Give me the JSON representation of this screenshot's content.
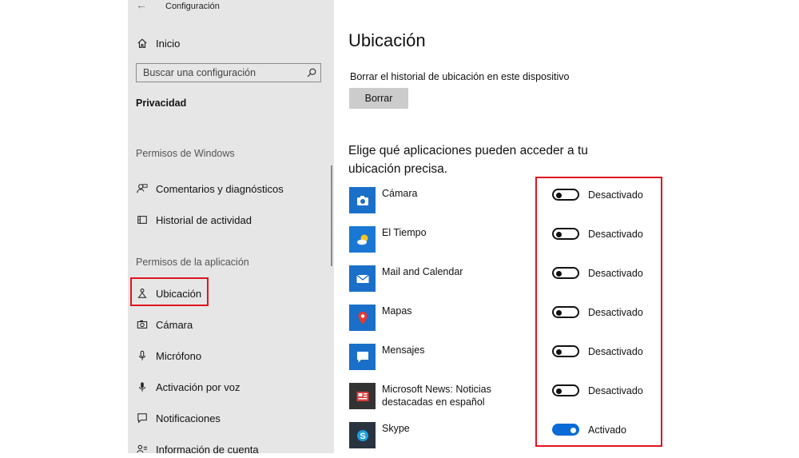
{
  "window": {
    "title": "Configuración"
  },
  "sidebar": {
    "home_label": "Inicio",
    "search_placeholder": "Buscar una configuración",
    "category": "Privacidad",
    "sections": [
      {
        "label": "Permisos de Windows"
      },
      {
        "label": "Permisos de la aplicación"
      }
    ],
    "items": [
      {
        "label": "Comentarios y diagnósticos",
        "icon": "feedback-icon"
      },
      {
        "label": "Historial de actividad",
        "icon": "activity-history-icon"
      },
      {
        "label": "Ubicación",
        "icon": "location-icon",
        "selected": true
      },
      {
        "label": "Cámara",
        "icon": "camera-icon"
      },
      {
        "label": "Micrófono",
        "icon": "microphone-icon"
      },
      {
        "label": "Activación por voz",
        "icon": "voice-activation-icon"
      },
      {
        "label": "Notificaciones",
        "icon": "notifications-icon"
      },
      {
        "label": "Información de cuenta",
        "icon": "account-info-icon"
      }
    ]
  },
  "main": {
    "title": "Ubicación",
    "clear_description": "Borrar el historial de ubicación en este dispositivo",
    "clear_button": "Borrar",
    "apps_heading": "Elige qué aplicaciones pueden acceder a tu ubicación precisa.",
    "apps": [
      {
        "name": "Cámara",
        "state": "Desactivado",
        "on": false,
        "icon": "camera-app-icon",
        "color": "#1a6fc9"
      },
      {
        "name": "El Tiempo",
        "state": "Desactivado",
        "on": false,
        "icon": "weather-app-icon",
        "color": "#1a78d4"
      },
      {
        "name": "Mail and Calendar",
        "state": "Desactivado",
        "on": false,
        "icon": "mail-app-icon",
        "color": "#1a6fc9"
      },
      {
        "name": "Mapas",
        "state": "Desactivado",
        "on": false,
        "icon": "maps-app-icon",
        "color": "#1a6fc9"
      },
      {
        "name": "Mensajes",
        "state": "Desactivado",
        "on": false,
        "icon": "messages-app-icon",
        "color": "#1a6fc9"
      },
      {
        "name": "Microsoft News: Noticias destacadas en español",
        "state": "Desactivado",
        "on": false,
        "icon": "news-app-icon",
        "color": "#333333"
      },
      {
        "name": "Skype",
        "state": "Activado",
        "on": true,
        "icon": "skype-app-icon",
        "color": "#2a3440"
      }
    ]
  },
  "colors": {
    "accent": "#0a6bd6",
    "highlight": "#e0141e",
    "sidebar_bg": "#e6e6e6"
  }
}
